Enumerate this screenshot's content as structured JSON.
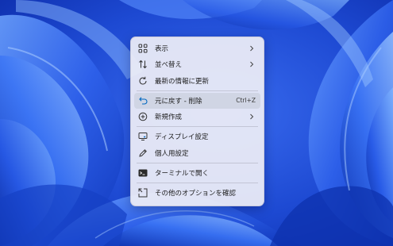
{
  "menu": {
    "items": [
      {
        "label": "表示",
        "icon": "view-grid-icon",
        "submenu": true
      },
      {
        "label": "並べ替え",
        "icon": "sort-icon",
        "submenu": true
      },
      {
        "label": "最新の情報に更新",
        "icon": "refresh-icon"
      },
      {
        "label": "元に戻す - 削除",
        "icon": "undo-icon",
        "shortcut": "Ctrl+Z",
        "highlighted": true
      },
      {
        "label": "新規作成",
        "icon": "add-circle-icon",
        "submenu": true
      },
      {
        "label": "ディスプレイ設定",
        "icon": "display-settings-icon"
      },
      {
        "label": "個人用設定",
        "icon": "personalize-pen-icon"
      },
      {
        "label": "ターミナルで開く",
        "icon": "terminal-icon"
      },
      {
        "label": "その他のオプションを確認",
        "icon": "more-options-icon"
      }
    ]
  },
  "colors": {
    "wallpaper_blue": "#1f4fd6",
    "menu_bg": "#eeeef6",
    "accent": "#0067c0"
  }
}
